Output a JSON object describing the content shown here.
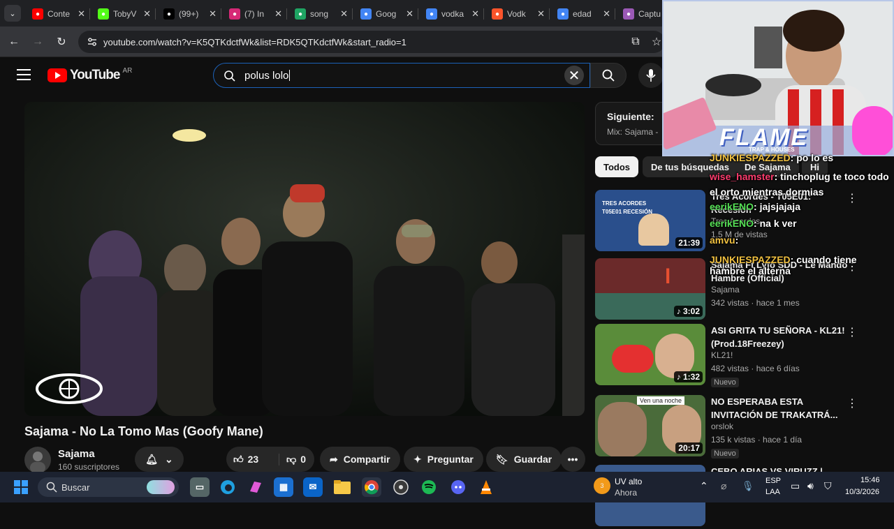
{
  "browser": {
    "tabs": [
      {
        "label": "Conte",
        "icon": "youtube-icon",
        "color": "#ff0000"
      },
      {
        "label": "TobyV",
        "icon": "kick-icon",
        "color": "#53fc18"
      },
      {
        "label": "(99+)",
        "icon": "tiktok-icon",
        "color": "#000000"
      },
      {
        "label": "(7) In",
        "icon": "instagram-icon",
        "color": "#d62976"
      },
      {
        "label": "song",
        "icon": "drive-icon",
        "color": "#1fa463"
      },
      {
        "label": "Goog",
        "icon": "drive-icon",
        "color": "#4285f4"
      },
      {
        "label": "vodka",
        "icon": "google-icon",
        "color": "#4285f4"
      },
      {
        "label": "Vodk",
        "icon": "brave-icon",
        "color": "#fb542b"
      },
      {
        "label": "edad",
        "icon": "google-icon",
        "color": "#4285f4"
      },
      {
        "label": "Captu",
        "icon": "pen-icon",
        "color": "#9b59b6"
      }
    ],
    "url": "youtube.com/watch?v=K5QTKdctfWk&list=RDK5QTKdctfWk&start_radio=1"
  },
  "youtube": {
    "logo_text": "YouTube",
    "region": "AR",
    "search_value": "polus lolo"
  },
  "video": {
    "title": "Sajama - No La Tomo Mas (Goofy Mane)",
    "channel": "Sajama",
    "subscribers": "160 suscriptores",
    "likes": "23",
    "dislikes": "0",
    "share_label": "Compartir",
    "ask_label": "Preguntar",
    "save_label": "Guardar"
  },
  "sidebar": {
    "next_label": "Siguiente:",
    "mix_label": "Mix: Sajama -",
    "chips": [
      "Todos",
      "De tus búsquedas",
      "De Sajama",
      "Hi"
    ],
    "recs": [
      {
        "title": "Tres Acordes - T05E01:",
        "title2": "Recesión",
        "channel": "Tres Acordes",
        "meta": "1,5 M de vistas",
        "duration": "21:39",
        "thumb_color": "#2a4f8c"
      },
      {
        "title": "Sajama Ft Lyfo SDD - Le Mando",
        "title2": "Hambre (Official)",
        "channel": "Sajama",
        "meta": "342 vistas · hace 1 mes",
        "duration": "♪ 3:02",
        "thumb_color": "#6b2a2a"
      },
      {
        "title": "ASI GRITA TU SEÑORA - KL21!",
        "title2": "(Prod.18Freezey)",
        "channel": "KL21!",
        "meta": "482 vistas · hace 6 días",
        "duration": "♪ 1:32",
        "badge": "Nuevo",
        "thumb_color": "#5a8c3a"
      },
      {
        "title": "NO ESPERABA ESTA",
        "title2": "INVITACIÓN DE TRAKATRÁ...",
        "channel": "orslok",
        "meta": "135 k vistas · hace 1 día",
        "duration": "20:17",
        "badge": "Nuevo",
        "thumb_color": "#4a6b3a"
      },
      {
        "title": "CEBO ARIAS VS VIRUZZ | CARA",
        "title2": "",
        "channel": "",
        "meta": "",
        "duration": "",
        "thumb_color": "#3a5a8c"
      }
    ],
    "thumb_caption": "Ven una noche",
    "thumb0_text": "TRES ACORDES T05E01 RECESIÓN"
  },
  "stream_overlay": {
    "banner_text": "FLAME",
    "banner_sub": "TRAP & HOUSES",
    "chat": [
      {
        "user": "JUNKIESPAZZED",
        "msg": ": po lo es",
        "color": "#f0c040"
      },
      {
        "user": "wise_hamster",
        "msg": ": tinchoplug te toco todo el orto mientras dormias",
        "color": "#ff3c6e"
      },
      {
        "user": "eerikENO",
        "msg": ": jajsjajaja",
        "color": "#56e056"
      },
      {
        "user": "eerikENO",
        "msg": ": na k ver",
        "color": "#56e056"
      },
      {
        "user": "amvu",
        "msg": ":",
        "color": "#f0c040"
      },
      {
        "user": "JUNKIESPAZZED",
        "msg": ": cuando tiene",
        "msg2": "hambre el alterna",
        "color": "#f0c040"
      }
    ]
  },
  "taskbar": {
    "search_placeholder": "Buscar",
    "weather_title": "UV alto",
    "weather_sub": "Ahora",
    "weather_badge": "3",
    "lang_top": "ESP",
    "lang_bottom": "LAA",
    "time": "15:46",
    "date": "10/3/2026"
  }
}
